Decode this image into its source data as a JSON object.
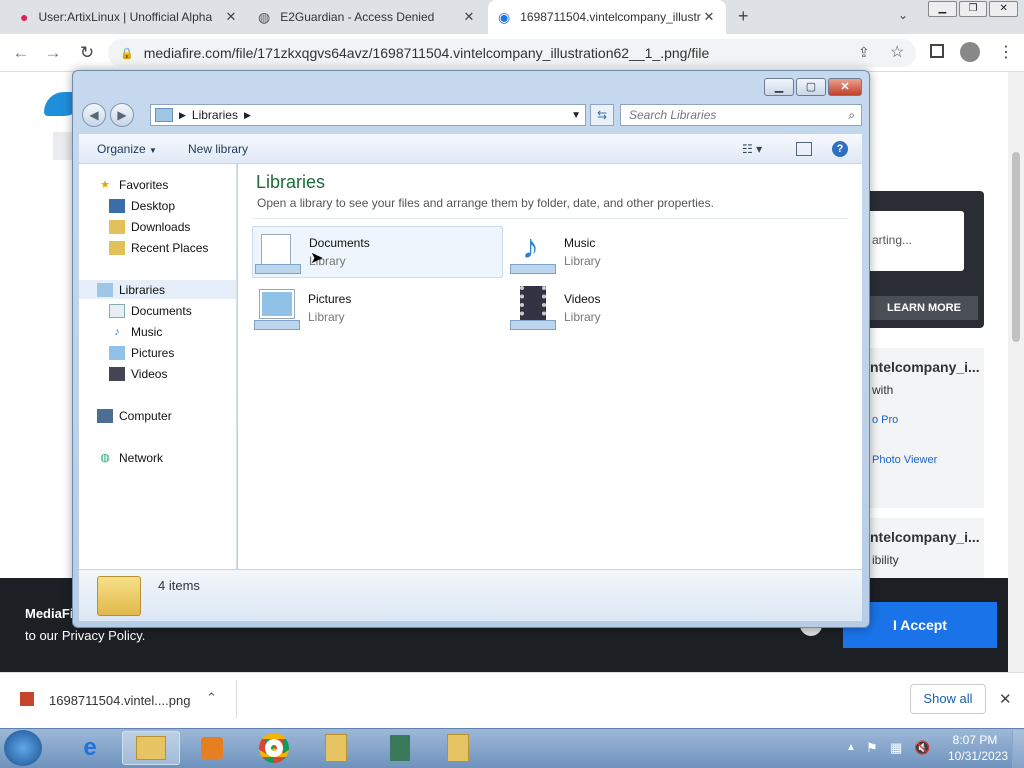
{
  "browser": {
    "tabs": [
      {
        "title": "User:ArtixLinux | Unofficial Alpha",
        "icon": "fandom-icon"
      },
      {
        "title": "E2Guardian - Access Denied",
        "icon": "globe-icon"
      },
      {
        "title": "1698711504.vintelcompany_illustr",
        "icon": "mediafire-icon",
        "active": true
      }
    ],
    "url": "mediafire.com/file/171zkxqgvs64avz/1698711504.vintelcompany_illustration62__1_.png/file"
  },
  "page": {
    "status_partial": "arting...",
    "learn_more": "LEARN MORE",
    "file_title_1": "ntelcompany_i...",
    "open_with": "with",
    "app1": "o Pro",
    "app2": "Photo Viewer",
    "file_title_2": "ntelcompany_i...",
    "compat": "ibility",
    "banner_brand": "MediaFi",
    "banner_policy": "to our Privacy Policy.",
    "accept": "I Accept"
  },
  "explorer": {
    "breadcrumb": "Libraries",
    "search_placeholder": "Search Libraries",
    "organize": "Organize",
    "new_library": "New library",
    "nav": {
      "favorites": "Favorites",
      "desktop": "Desktop",
      "downloads": "Downloads",
      "recent": "Recent Places",
      "libraries": "Libraries",
      "documents": "Documents",
      "music": "Music",
      "pictures": "Pictures",
      "videos": "Videos",
      "computer": "Computer",
      "network": "Network"
    },
    "heading": "Libraries",
    "subheading": "Open a library to see your files and arrange them by folder, date, and other properties.",
    "libraries": [
      {
        "name": "Documents",
        "type": "Library"
      },
      {
        "name": "Music",
        "type": "Library"
      },
      {
        "name": "Pictures",
        "type": "Library"
      },
      {
        "name": "Videos",
        "type": "Library"
      }
    ],
    "status": "4 items"
  },
  "downloads": {
    "file": "1698711504.vintel....png",
    "show_all": "Show all"
  },
  "clock": {
    "time": "8:07 PM",
    "date": "10/31/2023"
  }
}
